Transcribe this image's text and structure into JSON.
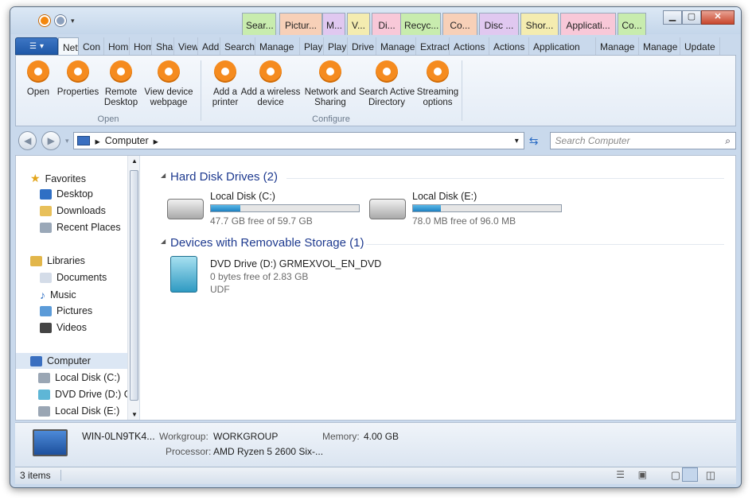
{
  "titlebar": {
    "context_tabs": [
      {
        "label": "Sear...",
        "color": "#c8ecae"
      },
      {
        "label": "Pictur...",
        "color": "#f7d0b8"
      },
      {
        "label": "M...",
        "color": "#e0c8f0"
      },
      {
        "label": "V...",
        "color": "#f4ecb0"
      },
      {
        "label": "Di...",
        "color": "#f8c8d8"
      },
      {
        "label": "Recyc...",
        "color": "#c8ecae"
      },
      {
        "label": "Co...",
        "color": "#f7d0b8"
      },
      {
        "label": "Disc ...",
        "color": "#e0c8f0"
      },
      {
        "label": "Shor...",
        "color": "#f4ecb0"
      },
      {
        "label": "Applicati...",
        "color": "#f8c8d8"
      },
      {
        "label": "Co...",
        "color": "#c8ecae"
      }
    ],
    "min": "▁",
    "max": "▢",
    "close": "✕"
  },
  "tabs": [
    "Netv",
    "Con",
    "Hom",
    "Hom",
    "Shar",
    "View",
    "Add",
    "Search",
    "Manage",
    "Play",
    "Play",
    "Drive",
    "Manage",
    "Extract",
    "Actions",
    "Actions",
    "Application",
    "Manage",
    "Manage",
    "Update"
  ],
  "ribbon": {
    "buttons": [
      "Open",
      "Properties",
      "Remote Desktop",
      "View device webpage",
      "Add a printer",
      "Add a wireless device",
      "Network and Sharing",
      "Search Active Directory",
      "Streaming options"
    ],
    "groups": [
      "Open",
      "Configure"
    ]
  },
  "address": {
    "path": "Computer",
    "search_placeholder": "Search Computer"
  },
  "nav": {
    "favorites": "Favorites",
    "desktop": "Desktop",
    "downloads": "Downloads",
    "recent": "Recent Places",
    "libraries": "Libraries",
    "documents": "Documents",
    "music": "Music",
    "pictures": "Pictures",
    "videos": "Videos",
    "computer": "Computer",
    "c": "Local Disk (C:)",
    "d": "DVD Drive (D:) GRMEXVOL_EN_DVD",
    "e": "Local Disk (E:)"
  },
  "content": {
    "hdd_title": "Hard Disk Drives (2)",
    "removable_title": "Devices with Removable Storage (1)",
    "c_name": "Local Disk (C:)",
    "c_free": "47.7 GB free of 59.7 GB",
    "c_used_fraction": 0.2,
    "e_name": "Local Disk (E:)",
    "e_free": "78.0 MB free of 96.0 MB",
    "e_used_fraction": 0.19,
    "d_name": "DVD Drive (D:) GRMEXVOL_EN_DVD",
    "d_free": "0 bytes free of 2.83 GB",
    "d_fs": "UDF"
  },
  "details": {
    "name": "WIN-0LN9TK4...",
    "workgroup_label": "Workgroup:",
    "workgroup": "WORKGROUP",
    "memory_label": "Memory:",
    "memory": "4.00 GB",
    "processor_label": "Processor:",
    "processor": "AMD Ryzen 5 2600 Six-..."
  },
  "status": {
    "items": "3 items"
  }
}
